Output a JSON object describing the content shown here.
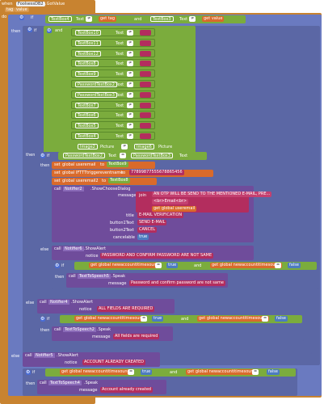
{
  "event": {
    "when": "when",
    "component": "FoolsessDB2",
    "event_name": ".GotValue",
    "params": [
      "tag",
      "value"
    ],
    "do": "do"
  },
  "kw": {
    "if": "if",
    "then": "then",
    "else": "else",
    "and": "and",
    "or": "or",
    "text": "Text",
    "eq": "=",
    "neq": "≠",
    "get": "get",
    "set": "set",
    "to": "to",
    "call": "call",
    "join": "join",
    "true": "true",
    "false": "false",
    "picture": "Picture"
  },
  "cond1": {
    "textbox4": "TextBox4",
    "tag": "tag",
    "textbox3": "TextBox3",
    "value": "value"
  },
  "checks": [
    "TextBox10",
    "TextBox11",
    "TextBox12",
    "TextBox8",
    "TextBox9",
    "PasswordTextBox2",
    "PasswordTextBox3",
    "TextBox7",
    "TextBox6",
    "TextBox5",
    "TextBox4"
  ],
  "images": {
    "img2": "Image2",
    "img6": "Image6"
  },
  "inner_if": {
    "pw2": "PasswordTextBox2",
    "pw3": "PasswordTextBox3"
  },
  "sets": {
    "s1_var": "global useremail",
    "s1_src": "TextBox9",
    "s2_var": "global IFTTTtriggereventname",
    "s2_val": "77899877555678865456",
    "s3_var": "global useremail2",
    "s3_src": "TextBox8"
  },
  "dialog": {
    "component": "Notifier2",
    "method": ".ShowChooseDialog",
    "message_label": "message",
    "part1": "AN OTP WILL BE SEND TO THE MENTIONED E-MAIL, PRE...",
    "part2": "<br>Email<br>",
    "part3_var": "global useremail",
    "title_label": "title",
    "title_val": "E-MAIL VERIFICATION",
    "b1_label": "button1Text",
    "b1_val": "SEND E-MAIL",
    "b2_label": "button2Text",
    "b2_val": "CANCEL",
    "cancel_label": "cancelable",
    "cancel_val": "true"
  },
  "else1": {
    "component": "Notifier6",
    "method": ".ShowAlert",
    "notice_label": "notice",
    "notice_val": "PASSWORD AND CONFIRM PASSWORD ARE NOT SAME",
    "var1": "global newaccountitimesound",
    "var2": "global newaccountitimesound",
    "tts_component": "TextToSpeech5",
    "tts_method": ".Speak",
    "tts_label": "message",
    "tts_val": "Password and confirm password are not same"
  },
  "else2": {
    "component": "Notifier4",
    "method": ".ShowAlert",
    "notice_label": "notice",
    "notice_val": "ALL FIELDS ARE REQUIRED",
    "var1": "global newaccountitimesound",
    "var2": "global newaccountitimesound",
    "tts_component": "TextToSpeech2",
    "tts_method": ".Speak",
    "tts_label": "message",
    "tts_val": "All fields are required"
  },
  "else3": {
    "component": "Notifier5",
    "method": ".ShowAlert",
    "notice_label": "notice",
    "notice_val": "ACCOUNT ALREADY CREATED",
    "var1": "global newaccountitimesound",
    "var2": "global newaccountitimesound",
    "tts_component": "TextToSpeech4",
    "tts_method": ".Speak",
    "tts_label": "message",
    "tts_val": "Account already created"
  }
}
